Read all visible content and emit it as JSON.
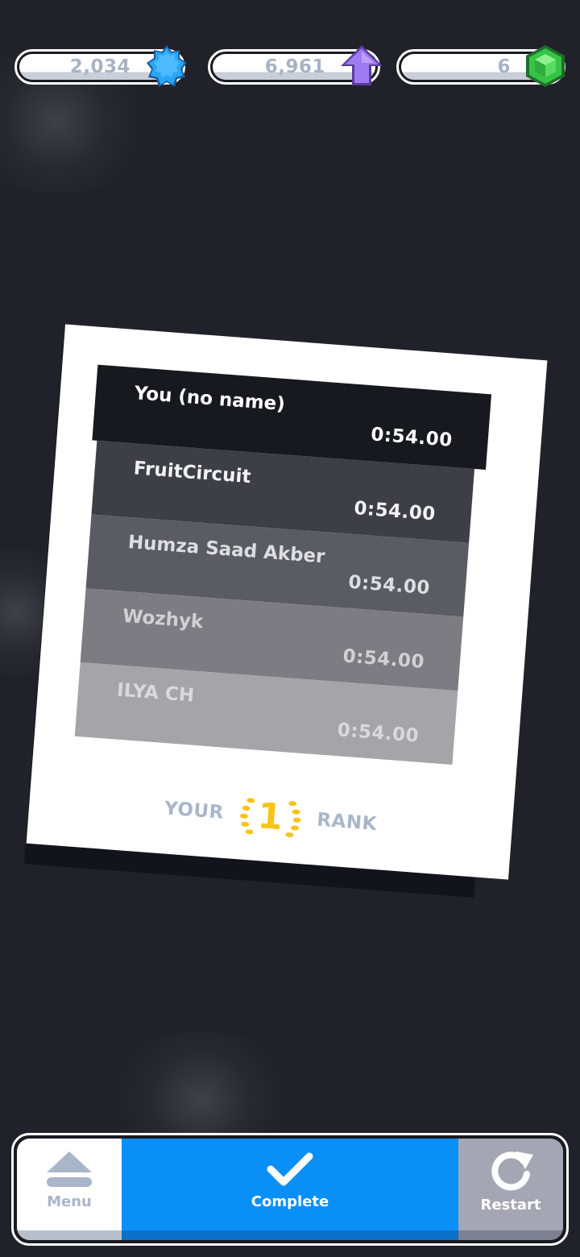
{
  "currencies": [
    {
      "value": "2,034",
      "icon": "blue-star-badge-icon",
      "color": "#29a3f5"
    },
    {
      "value": "6,961",
      "icon": "purple-up-arrow-icon",
      "color": "#9b72e8"
    },
    {
      "value": "6",
      "icon": "green-cube-gem-icon",
      "color": "#2fbd3c"
    }
  ],
  "leaderboard": {
    "rows": [
      {
        "name": "You (no name)",
        "time": "0:54.00"
      },
      {
        "name": "FruitCircuit",
        "time": "0:54.00"
      },
      {
        "name": "Humza Saad Akber",
        "time": "0:54.00"
      },
      {
        "name": "Wozhyk",
        "time": "0:54.00"
      },
      {
        "name": "ILYA CH",
        "time": "0:54.00"
      }
    ],
    "rank_prefix": "YOUR",
    "rank_value": "1",
    "rank_suffix": "RANK",
    "rank_color": "#f7c414"
  },
  "actions": {
    "menu_label": "Menu",
    "complete_label": "Complete",
    "restart_label": "Restart",
    "complete_color": "#0a8ff7"
  }
}
